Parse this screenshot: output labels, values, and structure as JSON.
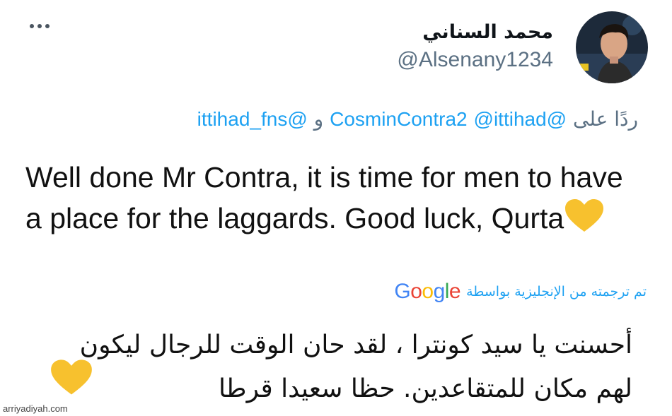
{
  "tweet": {
    "author_name": "محمد السناني",
    "handle": "@Alsenany1234",
    "more_icon": "more-horizontal-icon",
    "reply_to": {
      "prefix": "ردًا على",
      "mentions": [
        "@CosminContra2",
        "@ittihad"
      ],
      "conjunction": "و",
      "last_mention": "@ittihad_fns"
    },
    "text": "Well done Mr Contra, it is time for men to have a place for the laggards. Good luck, Qurta",
    "emoji": "yellow-heart",
    "translation": {
      "label": "تم ترجمته من الإنجليزية بواسطة",
      "provider": {
        "letters": [
          "G",
          "o",
          "o",
          "g",
          "l",
          "e"
        ],
        "colors": [
          "#4285f4",
          "#ea4335",
          "#fbbc05",
          "#4285f4",
          "#34a853",
          "#ea4335"
        ]
      },
      "text": "أحسنت يا سيد كونترا ، لقد حان الوقت للرجال ليكون لهم مكان للمتقاعدين. حظا سعيدا قرطا"
    }
  },
  "colors": {
    "link": "#1da1f2",
    "muted": "#5b7083",
    "heart": "#f7c12e"
  },
  "watermark": "arriyadiyah.com"
}
